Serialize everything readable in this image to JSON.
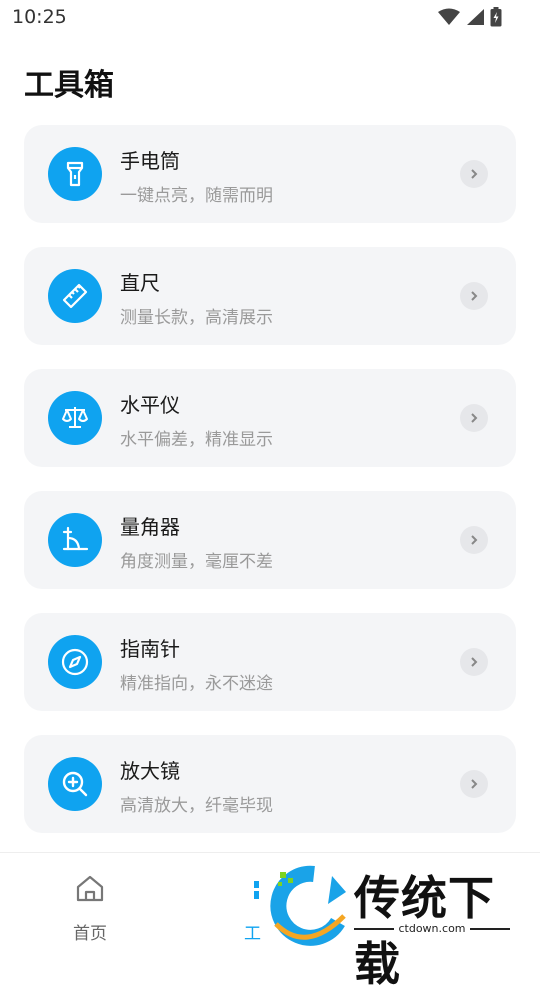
{
  "status_bar": {
    "time": "10:25"
  },
  "page_title": "工具箱",
  "tools": [
    {
      "name": "手电筒",
      "desc": "一键点亮，随需而明",
      "icon": "flashlight-icon"
    },
    {
      "name": "直尺",
      "desc": "测量长款，高清展示",
      "icon": "ruler-icon"
    },
    {
      "name": "水平仪",
      "desc": "水平偏差，精准显示",
      "icon": "scale-icon"
    },
    {
      "name": "量角器",
      "desc": "角度测量，毫厘不差",
      "icon": "protractor-icon"
    },
    {
      "name": "指南针",
      "desc": "精准指向，永不迷途",
      "icon": "compass-icon"
    },
    {
      "name": "放大镜",
      "desc": "高清放大，纤毫毕现",
      "icon": "magnifier-icon"
    }
  ],
  "bottom_nav": {
    "home_label": "首页",
    "tools_label": "工"
  },
  "watermark": {
    "text": "传统下载",
    "url": "ctdown.com"
  },
  "colors": {
    "accent": "#0fa3f0",
    "card_bg": "#f4f5f7",
    "desc_text": "#9a9a9a"
  }
}
